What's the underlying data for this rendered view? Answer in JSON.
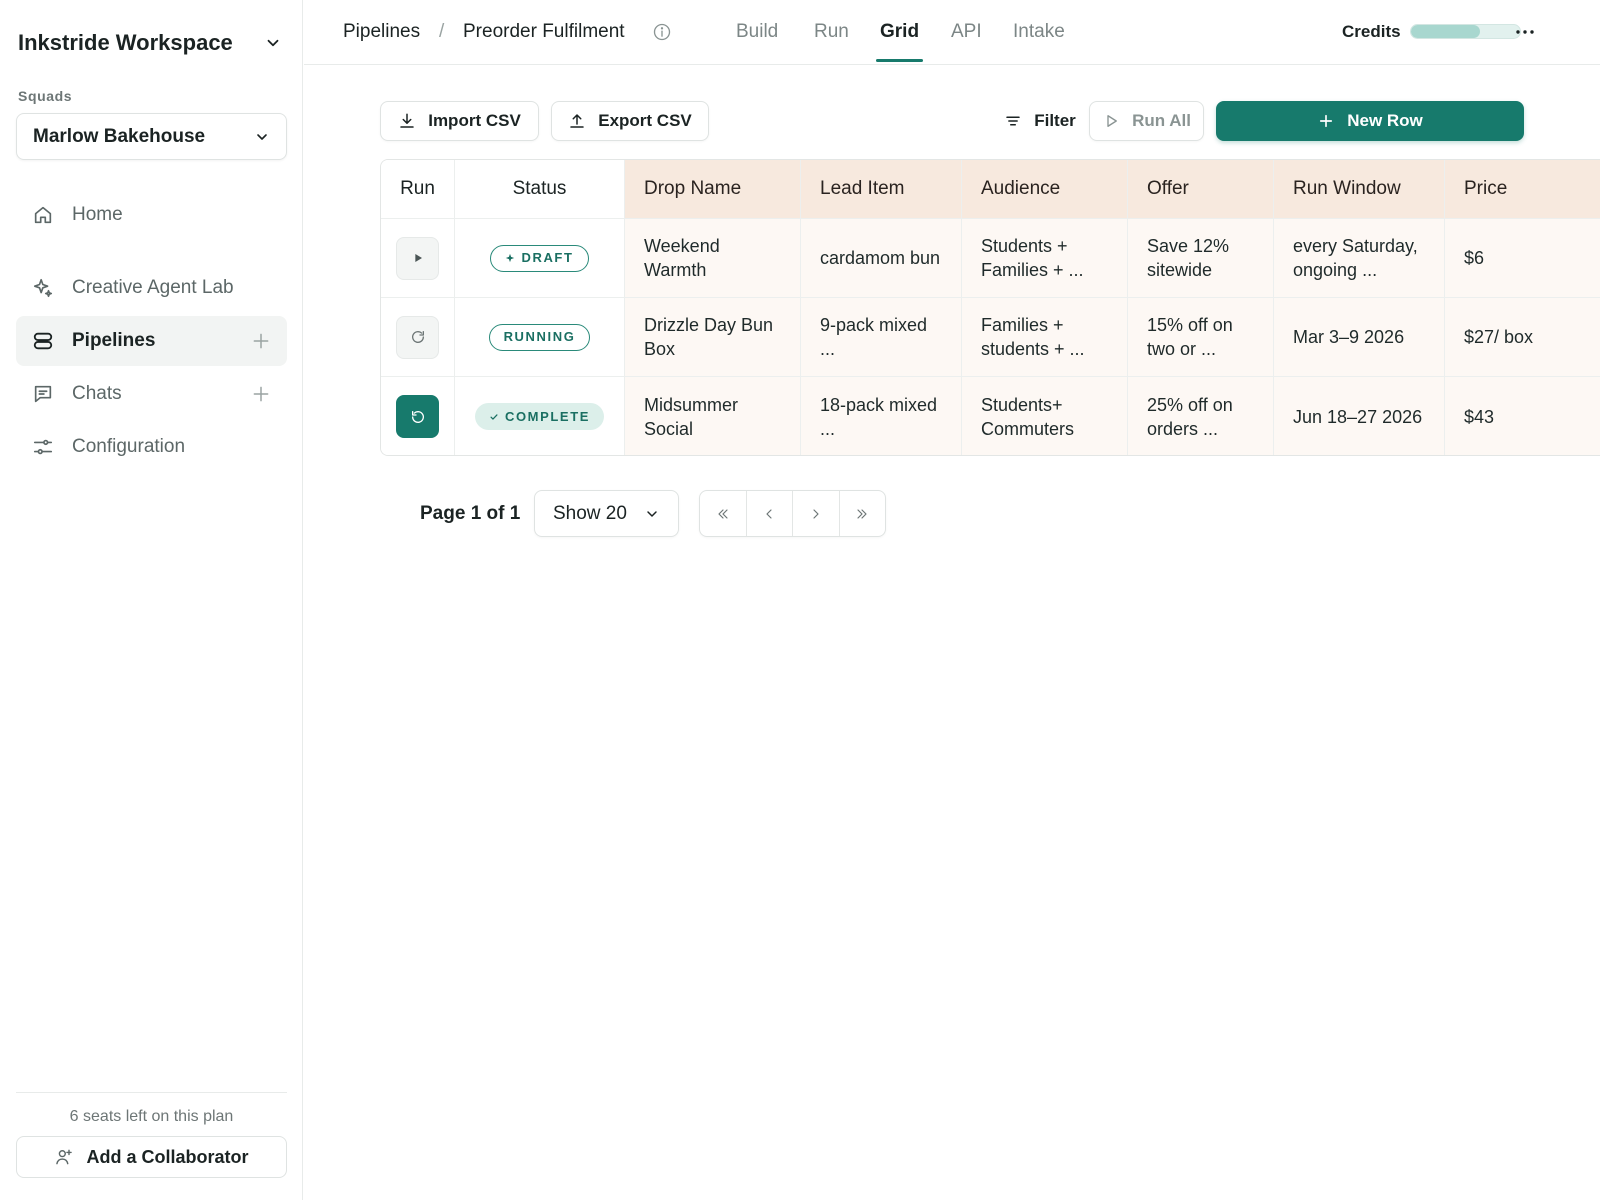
{
  "sidebar": {
    "workspace_name": "Inkstride Workspace",
    "squads_label": "Squads",
    "squad_selected": "Marlow Bakehouse",
    "nav": [
      {
        "label": "Home",
        "icon": "home-icon"
      },
      {
        "label": "Creative Agent Lab",
        "icon": "sparkle-icon"
      },
      {
        "label": "Pipelines",
        "icon": "pipelines-icon",
        "active": true
      },
      {
        "label": "Chats",
        "icon": "chat-icon"
      },
      {
        "label": "Configuration",
        "icon": "sliders-icon"
      }
    ],
    "seats_left": "6 seats left on this plan",
    "add_collaborator": "Add a Collaborator"
  },
  "topbar": {
    "breadcrumb": [
      "Pipelines",
      "Preorder Fulfilment"
    ],
    "breadcrumb_separator": "/",
    "tabs": [
      "Build",
      "Run",
      "Grid",
      "API",
      "Intake"
    ],
    "active_tab": "Grid",
    "credits_label": "Credits",
    "credits_fraction": 0.63
  },
  "toolbar": {
    "import_csv": "Import CSV",
    "export_csv": "Export CSV",
    "filter": "Filter",
    "run_all": "Run All",
    "new_row": "New Row"
  },
  "grid": {
    "columns": [
      "Run",
      "Status",
      "Drop Name",
      "Lead Item",
      "Audience",
      "Offer",
      "Run Window",
      "Price"
    ],
    "rows": [
      {
        "run_state": "idle",
        "status": "DRAFT",
        "drop_name": "Weekend Warmth",
        "lead_item": "cardamom bun",
        "audience": "Students + Families + ...",
        "offer": "Save 12% sitewide",
        "run_window": "every Saturday, ongoing ...",
        "price": "$6"
      },
      {
        "run_state": "running",
        "status": "RUNNING",
        "drop_name": "Drizzle Day Bun Box",
        "lead_item": "9-pack mixed ...",
        "audience": "Families + students + ...",
        "offer": "15% off on two or ...",
        "run_window": "Mar 3–9 2026",
        "price": "$27/ box"
      },
      {
        "run_state": "complete",
        "status": "COMPLETE",
        "drop_name": "Midsummer Social",
        "lead_item": "18-pack mixed ...",
        "audience": "Students+ Commuters",
        "offer": "25% off on orders ...",
        "run_window": "Jun 18–27 2026",
        "price": "$43"
      }
    ]
  },
  "pagination": {
    "page_label": "Page 1 of 1",
    "show": "Show 20"
  },
  "colors": {
    "accent": "#177a6c",
    "input_header_bg": "#f7e9de",
    "input_cell_bg": "#fdf8f4",
    "badge_complete_bg": "#dcefea"
  }
}
